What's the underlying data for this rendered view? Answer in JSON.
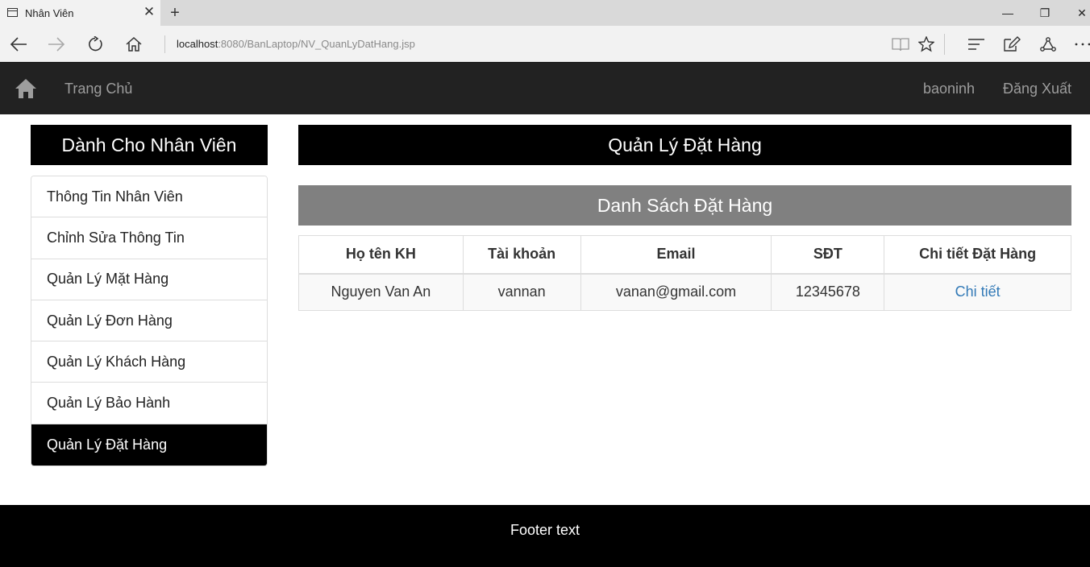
{
  "browser": {
    "tab_title": "Nhân Viên",
    "url_host": "localhost",
    "url_path": ":8080/BanLaptop/NV_QuanLyDatHang.jsp"
  },
  "navbar": {
    "home_label": "Trang Chủ",
    "username": "baoninh",
    "logout_label": "Đăng Xuất"
  },
  "sidebar": {
    "title": "Dành Cho Nhân Viên",
    "items": [
      {
        "label": "Thông Tin Nhân Viên"
      },
      {
        "label": "Chỉnh Sửa Thông Tin"
      },
      {
        "label": "Quản Lý Mặt Hàng"
      },
      {
        "label": "Quản Lý Đơn Hàng"
      },
      {
        "label": "Quản Lý Khách Hàng"
      },
      {
        "label": "Quản Lý Bảo Hành"
      },
      {
        "label": "Quản Lý Đặt Hàng"
      }
    ],
    "active_index": 6
  },
  "main": {
    "title": "Quản Lý Đặt Hàng",
    "subtitle": "Danh Sách Đặt Hàng",
    "table": {
      "headers": [
        "Họ tên KH",
        "Tài khoản",
        "Email",
        "SĐT",
        "Chi tiết Đặt Hàng"
      ],
      "rows": [
        {
          "name": "Nguyen Van An",
          "account": "vannan",
          "email": "vanan@gmail.com",
          "phone": "12345678",
          "detail_link": "Chi tiết"
        }
      ]
    }
  },
  "footer": {
    "text": "Footer text"
  }
}
